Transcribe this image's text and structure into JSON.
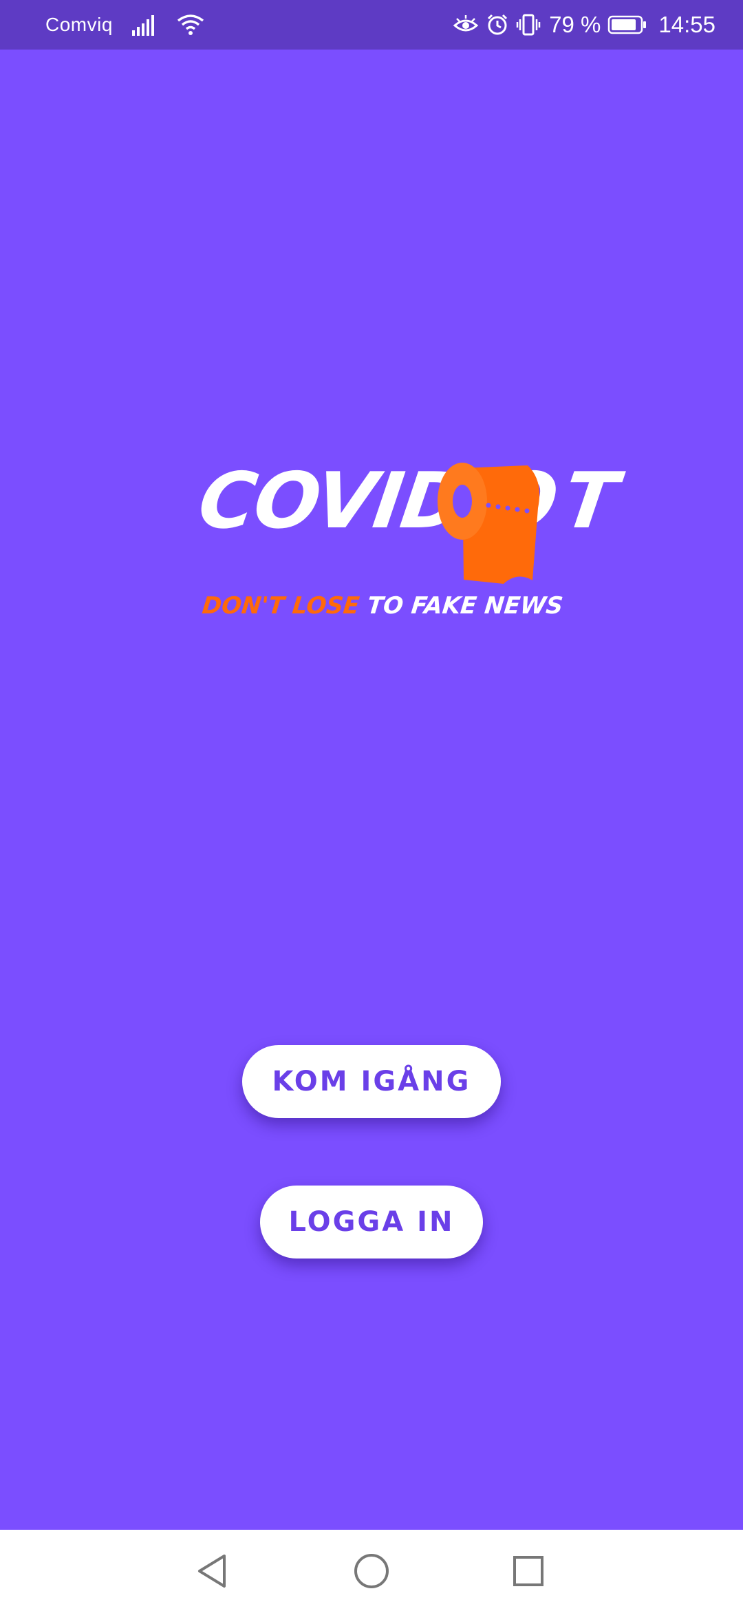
{
  "status_bar": {
    "carrier": "Comviq",
    "battery_percent": "79 %",
    "time": "14:55",
    "icons": [
      "signal-icon",
      "wifi-icon",
      "eye-icon",
      "alarm-icon",
      "vibrate-icon",
      "battery-icon"
    ]
  },
  "logo": {
    "wordmark": "COVIDIO",
    "wordmark_end": "T",
    "tagline_part1": "DON'T LOSE",
    "tagline_part2": "TO FAKE NEWS",
    "brand_white": "#FFFFFF",
    "brand_orange": "#FF6A0A"
  },
  "buttons": {
    "get_started": "KOM IGÅNG",
    "login": "LOGGA IN"
  },
  "navigation": {
    "back": "back-icon",
    "home": "home-icon",
    "recents": "recents-icon"
  },
  "colors": {
    "background": "#7B4EFF",
    "status_bar": "#5E3BC4",
    "button_text": "#6A3FE8"
  }
}
